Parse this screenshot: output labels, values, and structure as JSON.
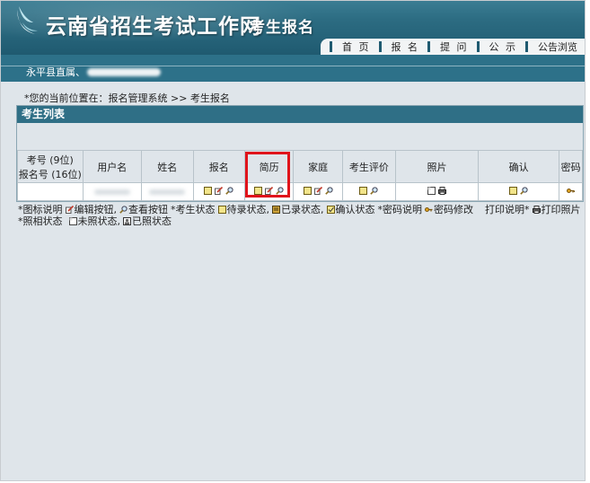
{
  "header": {
    "site_title": "云南省招生考试工作网",
    "sub_title": "考生报名",
    "nav": [
      "首 页",
      "报 名",
      "提 问",
      "公 示",
      "公告浏览"
    ]
  },
  "user": {
    "prefix": "永平县直属、"
  },
  "breadcrumb": "*您的当前位置在：报名管理系统 >> 考生报名",
  "panel": {
    "title": "考生列表",
    "columns": {
      "exam_no_line1": "考号 (9位)",
      "exam_no_line2": "报名号 (16位)",
      "username": "用户名",
      "name": "姓名",
      "registration": "报名",
      "resume": "简历",
      "family": "家庭",
      "evaluation": "考生评价",
      "photo": "照片",
      "confirm": "确认",
      "password": "密码"
    }
  },
  "legend": {
    "row1": {
      "icon_desc": "*图标说明",
      "edit": "编辑按钮,",
      "view": "查看按钮",
      "status": "*考生状态",
      "pending": "待录状态,",
      "recorded": "已录状态,",
      "confirmed": "确认状态",
      "pwd_desc": "*密码说明",
      "pwd_change": "密码修改",
      "print_desc": "打印说明*",
      "print_photo": "打印照片"
    },
    "row2": {
      "photo_status": "*照相状态",
      "not_photo": "未照状态,",
      "photo_done": "已照状态"
    }
  },
  "colors": {
    "header_bg": "#2c6c82",
    "panel_title_bg": "#2f6f86",
    "page_bg": "#dfe5ea",
    "highlight": "#e0141b"
  },
  "icons": [
    "leaf-logo-icon",
    "pending-status-icon",
    "edit-pencil-icon",
    "view-magnifier-icon",
    "confirm-status-icon",
    "recorded-status-icon",
    "not-photo-icon",
    "print-icon",
    "key-icon"
  ]
}
